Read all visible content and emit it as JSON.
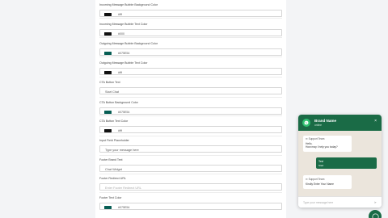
{
  "settings": {
    "fields": [
      {
        "label": "Incoming Message Bubble Background Color",
        "value": "#fff",
        "swatch": "#111111"
      },
      {
        "label": "Incoming Message Bubble Text Color",
        "value": "#000",
        "swatch": "#111111"
      },
      {
        "label": "Outgoing Message Bubble Background Color",
        "value": "#075E54",
        "swatch": "#075E54"
      },
      {
        "label": "Outgoing Message Bubble Text Color",
        "value": "#fff",
        "swatch": "#111111"
      },
      {
        "label": "CTA Button Text",
        "value": "Start Chat"
      },
      {
        "label": "CTA Button Background Color",
        "value": "#075E54",
        "swatch": "#075E54"
      },
      {
        "label": "CTA Button Text Color",
        "value": "#fff",
        "swatch": "#111111"
      },
      {
        "label": "Input Field Placeholder",
        "value": "Type your message here"
      },
      {
        "label": "Footer Brand Text",
        "value": "Chat Widget"
      },
      {
        "label": "Footer Redirect URL",
        "placeholder": "Enter Footer Redirect URL"
      },
      {
        "label": "Footer Text Color",
        "value": "#075E54",
        "swatch": "#075E54"
      }
    ]
  },
  "widget": {
    "brand_name": "Brand Name",
    "status": "online",
    "close": "×",
    "messages": [
      {
        "agent": "Support Team",
        "lines": [
          "Hello,",
          "How may I help you today?"
        ]
      },
      {
        "text_lines": [
          "Test",
          "Start"
        ]
      },
      {
        "agent": "Support Team",
        "lines": [
          "Kindly Enter Your Name"
        ]
      }
    ],
    "input_placeholder": "Type your message here",
    "send_icon": "send-icon"
  },
  "colors": {
    "brand_green": "#1a6b46",
    "chat_bg": "#ebe5dc"
  }
}
